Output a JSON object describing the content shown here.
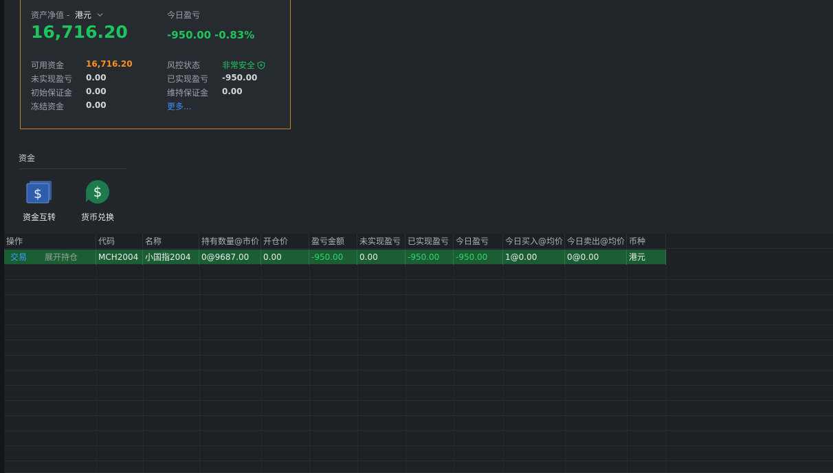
{
  "asset_card": {
    "net_value_label": "资产净值 -",
    "currency": "港元",
    "net_value": "16,716.20",
    "today_pnl_label": "今日盈亏",
    "today_pnl": "-950.00",
    "today_pnl_pct": "-0.83%",
    "rows": [
      {
        "label": "可用资金",
        "value": "16,716.20"
      },
      {
        "label": "未实现盈亏",
        "value": "0.00"
      },
      {
        "label": "初始保证金",
        "value": "0.00"
      },
      {
        "label": "冻结资金",
        "value": "0.00"
      }
    ],
    "right_rows": [
      {
        "label": "风控状态",
        "value": "非常安全"
      },
      {
        "label": "已实现盈亏",
        "value": "-950.00"
      },
      {
        "label": "维持保证金",
        "value": "0.00"
      }
    ],
    "more_link": "更多..."
  },
  "funds": {
    "title": "资金",
    "buttons": [
      {
        "label": "资金互转",
        "icon": "fund-transfer-icon"
      },
      {
        "label": "货币兑换",
        "icon": "currency-exchange-icon"
      }
    ]
  },
  "positions_table": {
    "headers": [
      "操作",
      "代码",
      "名称",
      "持有数量@市价",
      "开仓价",
      "盈亏金额",
      "未实现盈亏",
      "已实现盈亏",
      "今日盈亏",
      "今日买入@均价",
      "今日卖出@均价",
      "币种"
    ],
    "rows": [
      {
        "action_trade": "交易",
        "action_expand": "展开持仓",
        "code": "MCH2004",
        "name": "小国指2004",
        "qty_price": "0@9687.00",
        "open_price": "0.00",
        "pnl": "-950.00",
        "unrealized": "0.00",
        "realized": "-950.00",
        "today_pnl": "-950.00",
        "today_buy": "1@0.00",
        "today_sell": "0@0.00",
        "currency": "港元"
      }
    ]
  },
  "colors": {
    "accent_border": "#c8811e",
    "positive_green": "#1fc45e",
    "highlight_orange": "#ff8f1f",
    "link_blue": "#3d8ef0",
    "selected_row": "#1c5e34"
  }
}
